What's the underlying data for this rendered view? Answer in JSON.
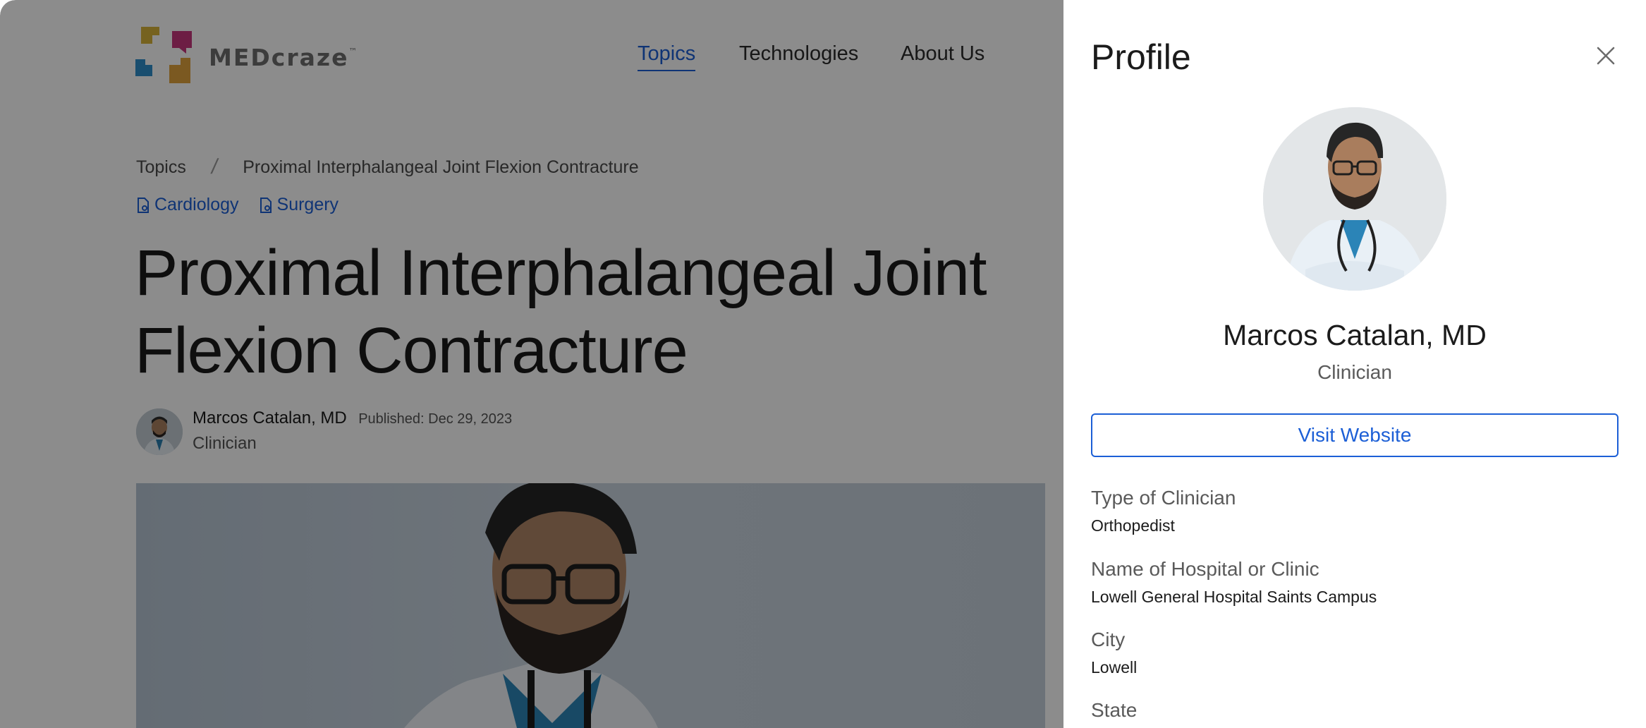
{
  "header": {
    "logo_text": "MEDcraze",
    "logo_trademark": "™",
    "nav": [
      {
        "label": "Topics",
        "active": true
      },
      {
        "label": "Technologies",
        "active": false
      },
      {
        "label": "About Us",
        "active": false
      }
    ]
  },
  "breadcrumb": {
    "items": [
      "Topics",
      "Proximal Interphalangeal Joint Flexion Contracture"
    ],
    "separator": "/"
  },
  "tags": [
    "Cardiology",
    "Surgery"
  ],
  "article": {
    "title_line1": "Proximal Interphalangeal Joint",
    "title_line2": "Flexion Contracture",
    "author_name": "Marcos Catalan, MD",
    "published": "Published: Dec 29, 2023",
    "author_role": "Clinician"
  },
  "profile": {
    "title": "Profile",
    "name": "Marcos Catalan, MD",
    "role": "Clinician",
    "visit_label": "Visit Website",
    "fields": [
      {
        "label": "Type of Clinician",
        "value": "Orthopedist"
      },
      {
        "label": "Name of Hospital or Clinic",
        "value": "Lowell General Hospital Saints Campus"
      },
      {
        "label": "City",
        "value": "Lowell"
      },
      {
        "label": "State",
        "value": ""
      }
    ]
  },
  "colors": {
    "accent": "#1c5fd6",
    "overlay": "rgba(0,0,0,0.45)",
    "logo_yellow": "#d8b23a",
    "logo_magenta": "#c7357d",
    "logo_blue": "#2f8ecb",
    "logo_orange": "#e0a23c"
  },
  "icons": {
    "close": "close-icon",
    "tag": "document-tag-icon"
  }
}
